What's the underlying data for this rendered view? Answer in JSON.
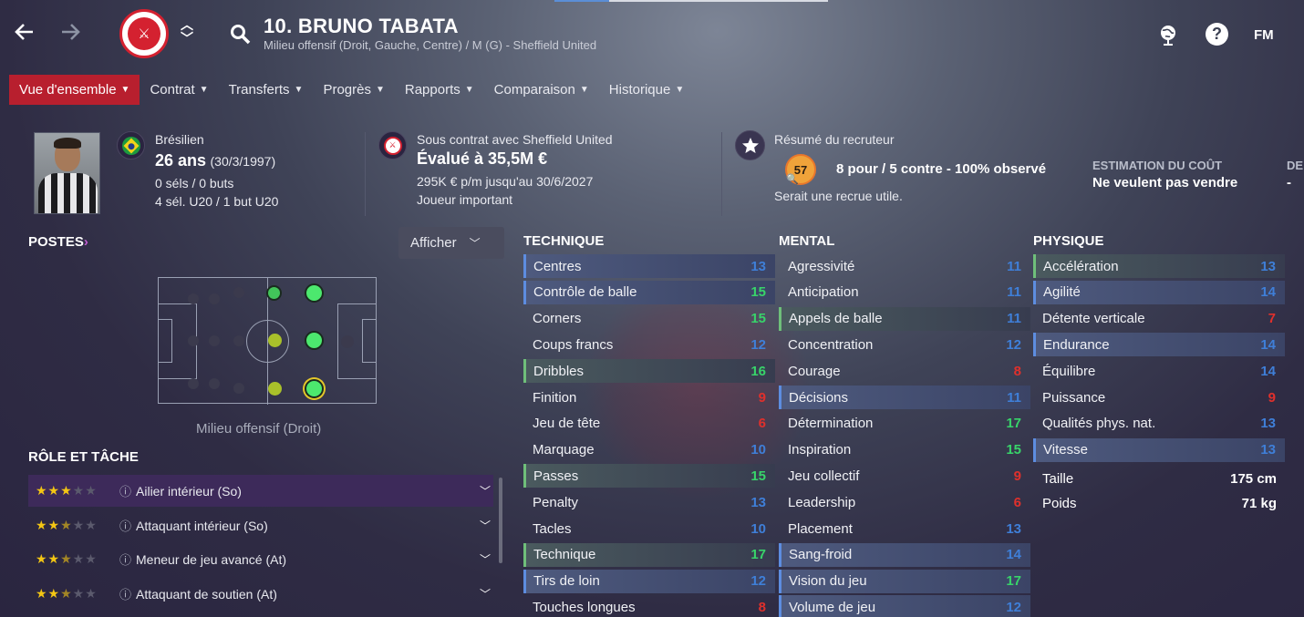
{
  "header": {
    "back_icon": "arrow-left-icon",
    "forward_icon": "arrow-right-icon",
    "crest_text": "SHEFFIELD UNITED",
    "title": "10. BRUNO TABATA",
    "subtitle": "Milieu offensif (Droit, Gauche, Centre) / M (G) - Sheffield United",
    "right_logo": "FM"
  },
  "menu": {
    "items": [
      {
        "label": "Vue d'ensemble",
        "active": true
      },
      {
        "label": "Contrat"
      },
      {
        "label": "Transferts"
      },
      {
        "label": "Progrès"
      },
      {
        "label": "Rapports"
      },
      {
        "label": "Comparaison"
      },
      {
        "label": "Historique"
      }
    ]
  },
  "info": {
    "nationality": "Brésilien",
    "age": "26 ans",
    "dob": "(30/3/1997)",
    "caps": "0 séls / 0 buts",
    "youth_caps": "4 sél. U20 / 1 but U20",
    "contract_line": "Sous contrat avec Sheffield United",
    "value": "Évalué à 35,5M €",
    "wage": "295K € p/m jusqu'au 30/6/2027",
    "squad_status": "Joueur important",
    "scout_title": "Résumé du recruteur",
    "scout_score": "57",
    "scout_summary": "8 pour / 5 contre - 100% observé",
    "scout_note": "Serait une recrue utile.",
    "cost_label": "ESTIMATION DU COÛT",
    "cost_value": "Ne veulent pas vendre",
    "cut_label": "DE",
    "cut_value": "-"
  },
  "positions": {
    "title": "POSTES",
    "button": "Afficher",
    "position_name": "Milieu offensif (Droit)"
  },
  "roles": {
    "title": "RÔLE ET TÂCHE",
    "items": [
      {
        "label": "Ailier intérieur (So)",
        "stars": 3
      },
      {
        "label": "Attaquant intérieur (So)",
        "stars": 2.5
      },
      {
        "label": "Meneur de jeu avancé (At)",
        "stars": 2.5
      },
      {
        "label": "Attaquant de soutien (At)",
        "stars": 2.5
      }
    ]
  },
  "technique": {
    "title": "TECHNIQUE",
    "items": [
      {
        "label": "Centres",
        "value": "13"
      },
      {
        "label": "Contrôle de balle",
        "value": "15"
      },
      {
        "label": "Corners",
        "value": "15"
      },
      {
        "label": "Coups francs",
        "value": "12"
      },
      {
        "label": "Dribbles",
        "value": "16"
      },
      {
        "label": "Finition",
        "value": "9"
      },
      {
        "label": "Jeu de tête",
        "value": "6"
      },
      {
        "label": "Marquage",
        "value": "10"
      },
      {
        "label": "Passes",
        "value": "15"
      },
      {
        "label": "Penalty",
        "value": "13"
      },
      {
        "label": "Tacles",
        "value": "10"
      },
      {
        "label": "Technique",
        "value": "17"
      },
      {
        "label": "Tirs de loin",
        "value": "12"
      },
      {
        "label": "Touches longues",
        "value": "8"
      }
    ]
  },
  "mental": {
    "title": "MENTAL",
    "items": [
      {
        "label": "Agressivité",
        "value": "11"
      },
      {
        "label": "Anticipation",
        "value": "11"
      },
      {
        "label": "Appels de balle",
        "value": "11"
      },
      {
        "label": "Concentration",
        "value": "12"
      },
      {
        "label": "Courage",
        "value": "8"
      },
      {
        "label": "Décisions",
        "value": "11"
      },
      {
        "label": "Détermination",
        "value": "17"
      },
      {
        "label": "Inspiration",
        "value": "15"
      },
      {
        "label": "Jeu collectif",
        "value": "9"
      },
      {
        "label": "Leadership",
        "value": "6"
      },
      {
        "label": "Placement",
        "value": "13"
      },
      {
        "label": "Sang-froid",
        "value": "14"
      },
      {
        "label": "Vision du jeu",
        "value": "17"
      },
      {
        "label": "Volume de jeu",
        "value": "12"
      }
    ]
  },
  "physique": {
    "title": "PHYSIQUE",
    "items": [
      {
        "label": "Accélération",
        "value": "13"
      },
      {
        "label": "Agilité",
        "value": "14"
      },
      {
        "label": "Détente verticale",
        "value": "7"
      },
      {
        "label": "Endurance",
        "value": "14"
      },
      {
        "label": "Équilibre",
        "value": "14"
      },
      {
        "label": "Puissance",
        "value": "9"
      },
      {
        "label": "Qualités phys. nat.",
        "value": "13"
      },
      {
        "label": "Vitesse",
        "value": "13"
      }
    ],
    "height_label": "Taille",
    "height_value": "175 cm",
    "weight_label": "Poids",
    "weight_value": "71 kg"
  }
}
